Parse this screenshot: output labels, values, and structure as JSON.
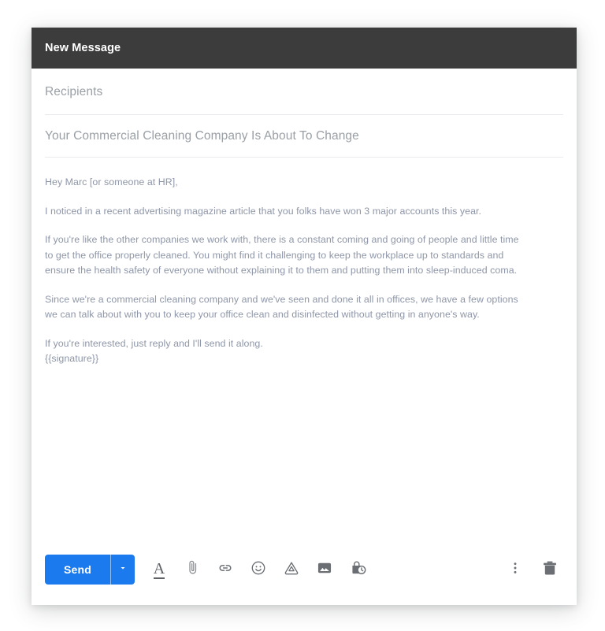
{
  "window": {
    "header_title": "New Message"
  },
  "fields": {
    "recipients_placeholder": "Recipients",
    "subject_value": "Your Commercial Cleaning Company Is About To Change"
  },
  "body": {
    "paragraphs": [
      "Hey Marc [or someone at HR],",
      "I noticed in a recent advertising magazine article that you folks have won 3 major accounts this year.",
      "If you're like the other companies we work with, there is a constant coming and going of people and little time to get the office properly cleaned. You might find it challenging to keep the workplace up to standards and ensure the health safety of everyone without explaining it to them and putting them into sleep-induced coma.",
      "Since we're a commercial cleaning company and we've seen and done it all in offices, we have a few options we can talk about with you to keep your office clean and disinfected without getting in anyone's way.",
      "If you're interested, just reply and I'll send it along.",
      "{{signature}}"
    ]
  },
  "toolbar": {
    "send_label": "Send",
    "send_dropdown_icon": "chevron-down-icon",
    "icons": [
      "format-text-icon",
      "attach-file-icon",
      "insert-link-icon",
      "insert-emoji-icon",
      "insert-drive-icon",
      "insert-photo-icon",
      "confidential-mode-icon"
    ],
    "more_options_icon": "more-vertical-icon",
    "discard_icon": "trash-icon"
  },
  "colors": {
    "header_bg": "#3c3c3c",
    "send_blue": "#1b7aed",
    "placeholder_gray": "#9aa0a6",
    "body_text": "#8e96a8",
    "icon_gray": "#5f6368",
    "divider": "#e8eaed"
  }
}
